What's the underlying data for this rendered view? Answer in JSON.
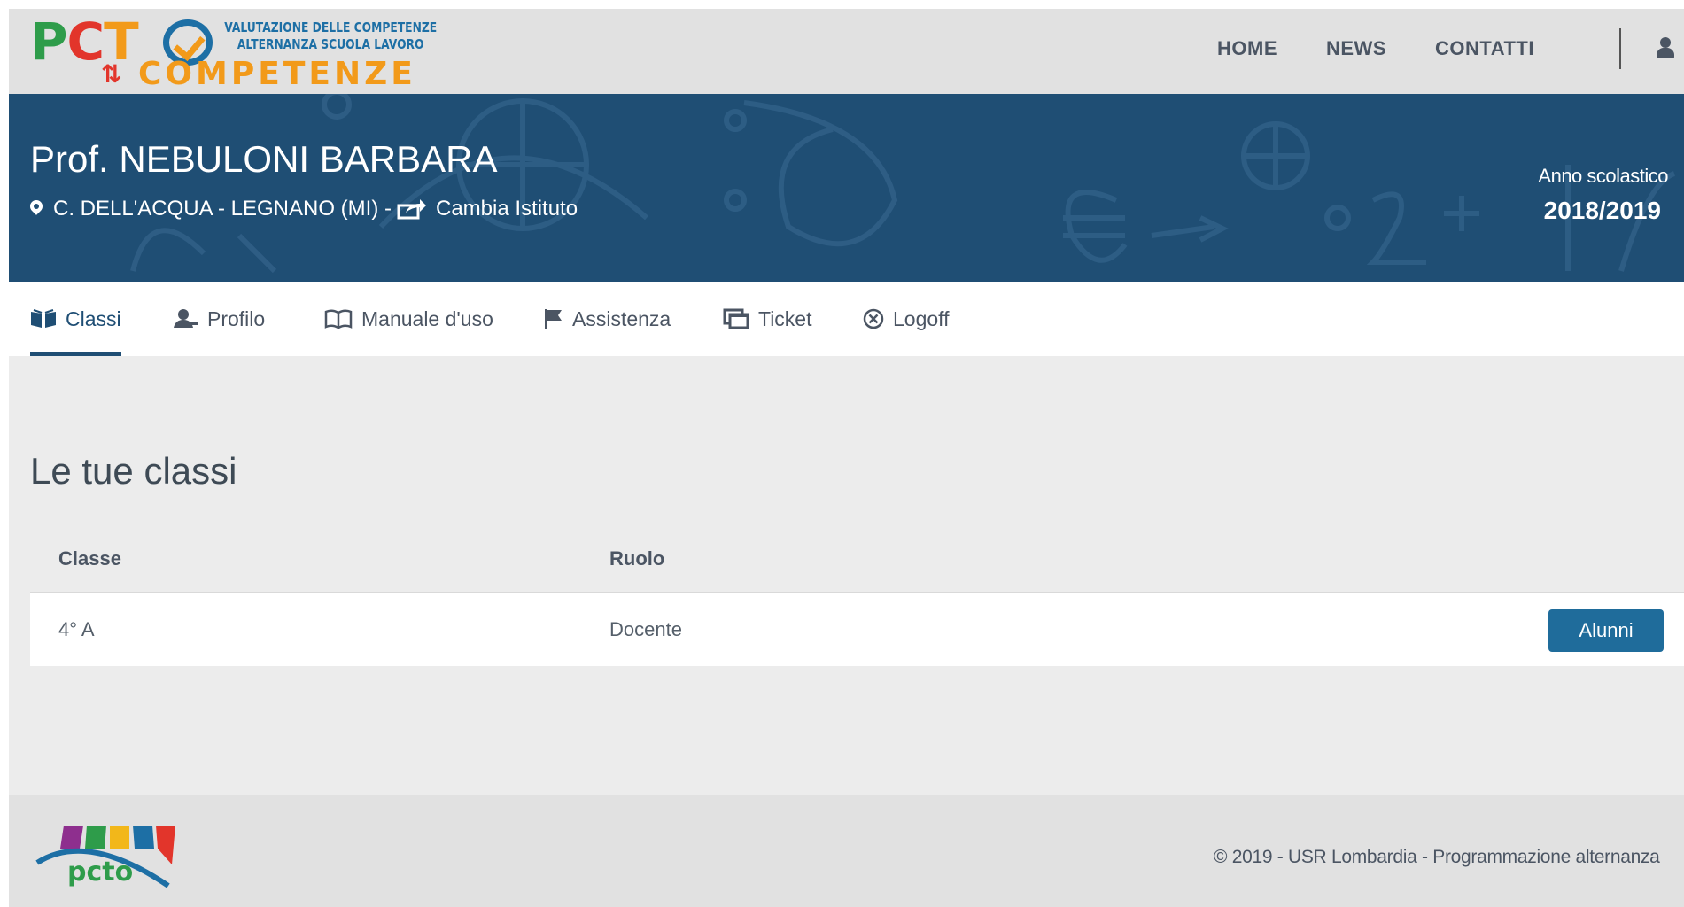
{
  "brand": {
    "logo_letters": [
      "P",
      "C",
      "T"
    ],
    "tagline_line1": "VALUTAZIONE DELLE COMPETENZE",
    "tagline_line2": "ALTERNANZA SCUOLA LAVORO",
    "wordmark": "COMPETENZE",
    "colors": {
      "green": "#2e9c4a",
      "red": "#e2352b",
      "orange": "#f29a1a",
      "blue": "#1d6fa5"
    }
  },
  "topnav": {
    "items": [
      {
        "label": "HOME"
      },
      {
        "label": "NEWS"
      },
      {
        "label": "CONTATTI"
      }
    ],
    "user_icon": "user-icon"
  },
  "hero": {
    "name": "Prof. NEBULONI BARBARA",
    "school": "C. DELL'ACQUA - LEGNANO (MI) -",
    "change_label": "Cambia Istituto",
    "year_label": "Anno scolastico",
    "year_value": "2018/2019",
    "background_color": "#1f4e74"
  },
  "tabs": [
    {
      "label": "Classi",
      "icon": "open-book-icon",
      "active": true
    },
    {
      "label": "Profilo",
      "icon": "user-icon"
    },
    {
      "label": "Manuale d'uso",
      "icon": "book-icon"
    },
    {
      "label": "Assistenza",
      "icon": "flag-icon"
    },
    {
      "label": "Ticket",
      "icon": "windows-icon"
    },
    {
      "label": "Logoff",
      "icon": "circle-x-icon"
    }
  ],
  "main": {
    "title": "Le tue classi",
    "table": {
      "headers": [
        "Classe",
        "Ruolo"
      ],
      "rows": [
        {
          "classe": "4° A",
          "ruolo": "Docente",
          "action_label": "Alunni"
        }
      ]
    }
  },
  "footer": {
    "logo_text": "pcto",
    "copyright": "© 2019 - USR Lombardia - Programmazione alternanza"
  }
}
